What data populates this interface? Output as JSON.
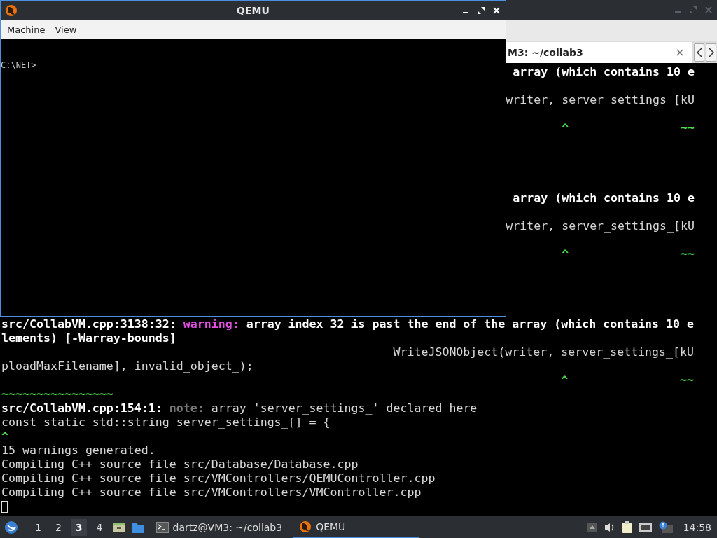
{
  "terminal": {
    "tab": {
      "label": "M3: ~/collab3"
    },
    "lines": [
      {
        "kind": "clipped",
        "segments": [
          {
            "text": "array (which contains 10 e",
            "kind": "bold"
          }
        ]
      },
      {
        "kind": "blank"
      },
      {
        "kind": "clipped",
        "segments": [
          {
            "text": "writer, server_settings_[kU",
            "kind": "plain"
          }
        ]
      },
      {
        "kind": "blank"
      },
      {
        "kind": "clipped",
        "segments": [
          {
            "text": "^                ~~",
            "kind": "marker"
          }
        ]
      },
      {
        "kind": "blank"
      },
      {
        "kind": "blank"
      },
      {
        "kind": "blank"
      },
      {
        "kind": "blank"
      },
      {
        "kind": "clipped",
        "segments": [
          {
            "text": "array (which contains 10 e",
            "kind": "bold"
          }
        ]
      },
      {
        "kind": "blank"
      },
      {
        "kind": "clipped",
        "segments": [
          {
            "text": "writer, server_settings_[kU",
            "kind": "plain"
          }
        ]
      },
      {
        "kind": "blank"
      },
      {
        "kind": "clipped",
        "segments": [
          {
            "text": "^                ~~",
            "kind": "marker"
          }
        ]
      },
      {
        "kind": "blank"
      },
      {
        "kind": "blank"
      },
      {
        "kind": "blank"
      },
      {
        "kind": "blank"
      },
      {
        "kind": "text",
        "segments": [
          {
            "text": "src/CollabVM.cpp:3138:32: ",
            "kind": "bold"
          },
          {
            "text": "warning: ",
            "kind": "warning"
          },
          {
            "text": "array index 32 is past the end of the array (which contains 10 e",
            "kind": "bold"
          }
        ]
      },
      {
        "kind": "text",
        "segments": [
          {
            "text": "lements) [-Warray-bounds]",
            "kind": "bold"
          }
        ]
      },
      {
        "kind": "text",
        "segments": [
          {
            "text": "                                                        WriteJSONObject(writer, server_settings_[kU",
            "kind": "plain"
          }
        ]
      },
      {
        "kind": "text",
        "segments": [
          {
            "text": "ploadMaxFilename], invalid_object_);",
            "kind": "plain"
          }
        ]
      },
      {
        "kind": "text",
        "segments": [
          {
            "text": "                                                                                ^                ~~",
            "kind": "marker"
          }
        ]
      },
      {
        "kind": "text",
        "segments": [
          {
            "text": "~~~~~~~~~~~~~~~~",
            "kind": "marker"
          }
        ]
      },
      {
        "kind": "text",
        "segments": [
          {
            "text": "src/CollabVM.cpp:154:1: ",
            "kind": "bold"
          },
          {
            "text": "note: ",
            "kind": "note"
          },
          {
            "text": "array 'server_settings_' declared here",
            "kind": "plain"
          }
        ]
      },
      {
        "kind": "text",
        "segments": [
          {
            "text": "const static std::string server_settings_[] = {",
            "kind": "plain"
          }
        ]
      },
      {
        "kind": "text",
        "segments": [
          {
            "text": "^",
            "kind": "marker"
          }
        ]
      },
      {
        "kind": "text",
        "segments": [
          {
            "text": "15 warnings generated.",
            "kind": "plain"
          }
        ]
      },
      {
        "kind": "text",
        "segments": [
          {
            "text": "Compiling C++ source file src/Database/Database.cpp",
            "kind": "plain"
          }
        ]
      },
      {
        "kind": "text",
        "segments": [
          {
            "text": "Compiling C++ source file src/VMControllers/QEMUController.cpp",
            "kind": "plain"
          }
        ]
      },
      {
        "kind": "text",
        "segments": [
          {
            "text": "Compiling C++ source file src/VMControllers/VMController.cpp",
            "kind": "plain"
          }
        ]
      },
      {
        "kind": "cursor"
      }
    ]
  },
  "qemu": {
    "title": "QEMU",
    "menu": [
      {
        "label": "Machine"
      },
      {
        "label": "View"
      }
    ],
    "screen_lines": [
      "C:\\NET>"
    ]
  },
  "taskbar": {
    "workspaces": [
      {
        "label": "1",
        "selected": false
      },
      {
        "label": "2",
        "selected": false
      },
      {
        "label": "3",
        "selected": true
      },
      {
        "label": "4",
        "selected": false
      }
    ],
    "tasks": [
      {
        "kind": "terminal",
        "label": "dartz@VM3: ~/collab3",
        "selected": false
      },
      {
        "kind": "qemu",
        "label": "QEMU",
        "selected": true
      }
    ],
    "clock": "14:58"
  }
}
